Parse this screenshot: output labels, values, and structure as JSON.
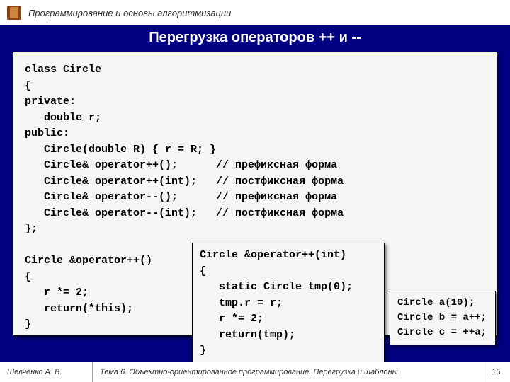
{
  "header": {
    "course_title": "Программирование и основы алгоритмизации"
  },
  "slide": {
    "title": "Перегрузка операторов ++ и --",
    "code_main": "class Circle\n{\nprivate:\n   double r;\npublic:\n   Circle(double R) { r = R; }\n   Circle& operator++();      // префиксная форма\n   Circle& operator++(int);   // постфиксная форма\n   Circle& operator--();      // префиксная форма\n   Circle& operator--(int);   // постфиксная форма\n};\n\nCircle &operator++()\n{\n   r *= 2;\n   return(*this);\n}",
    "code_box2": "Circle &operator++(int)\n{\n   static Circle tmp(0);\n   tmp.r = r;\n   r *= 2;\n   return(tmp);\n}",
    "code_box3": "Circle a(10);\nCircle b = a++;\nCircle c = ++a;"
  },
  "footer": {
    "author": "Шевченко А. В.",
    "topic": "Тема 6. Объектно-ориентированное программирование. Перегрузка и шаблоны",
    "page": "15"
  }
}
